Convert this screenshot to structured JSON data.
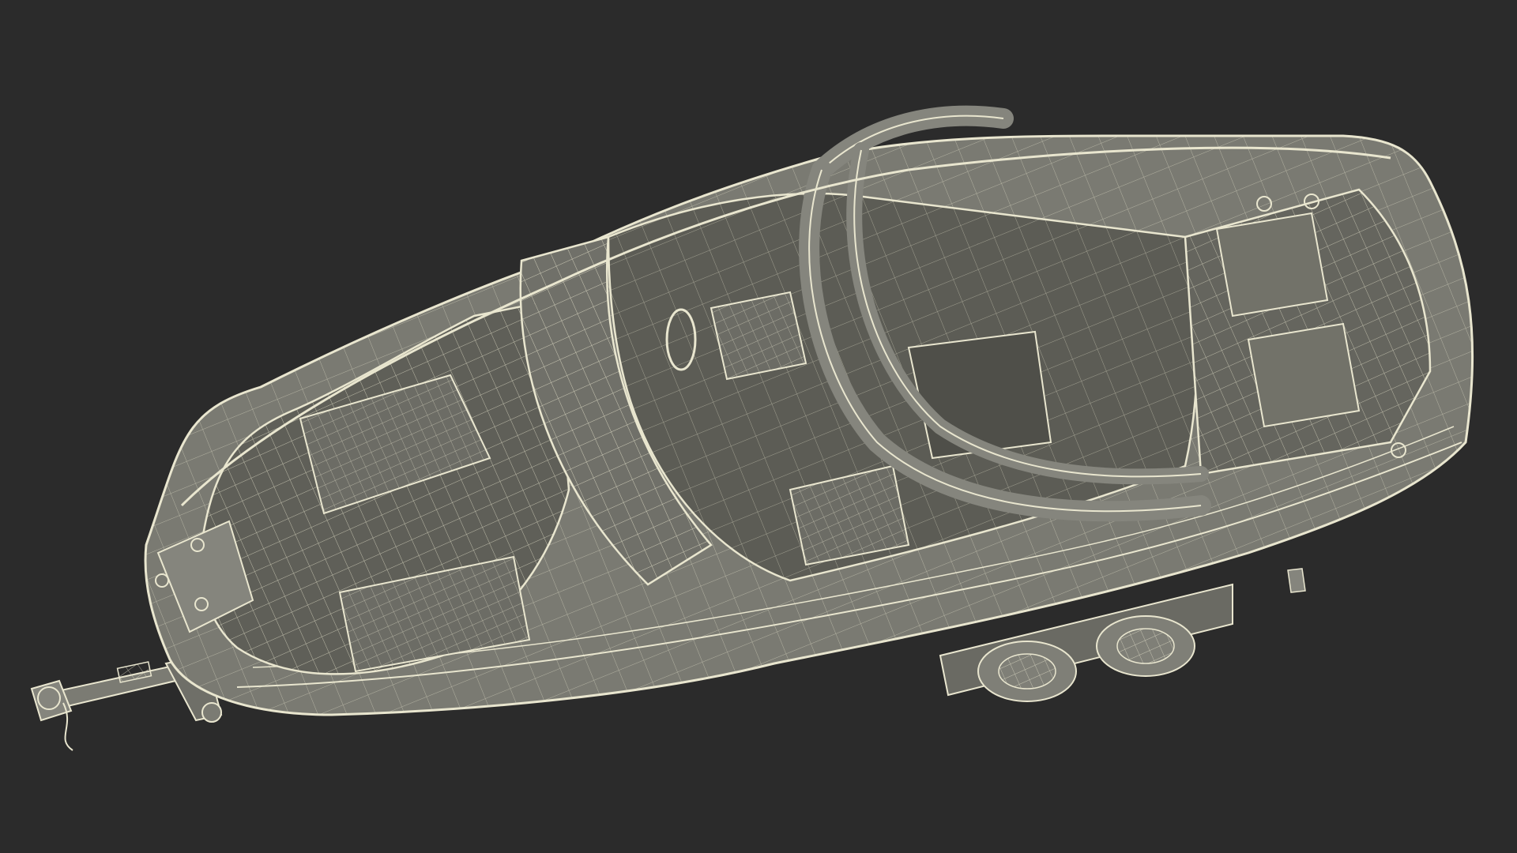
{
  "scene": {
    "subject": "wireframe-boat-on-trailer",
    "colors": {
      "background": "#2b2b2b",
      "surface": "#77776f",
      "surface_dark": "#5f5f58",
      "surface_light": "#8a8a82",
      "wire": "#e9e6cf",
      "wire_dim": "#c9c6b1"
    }
  }
}
